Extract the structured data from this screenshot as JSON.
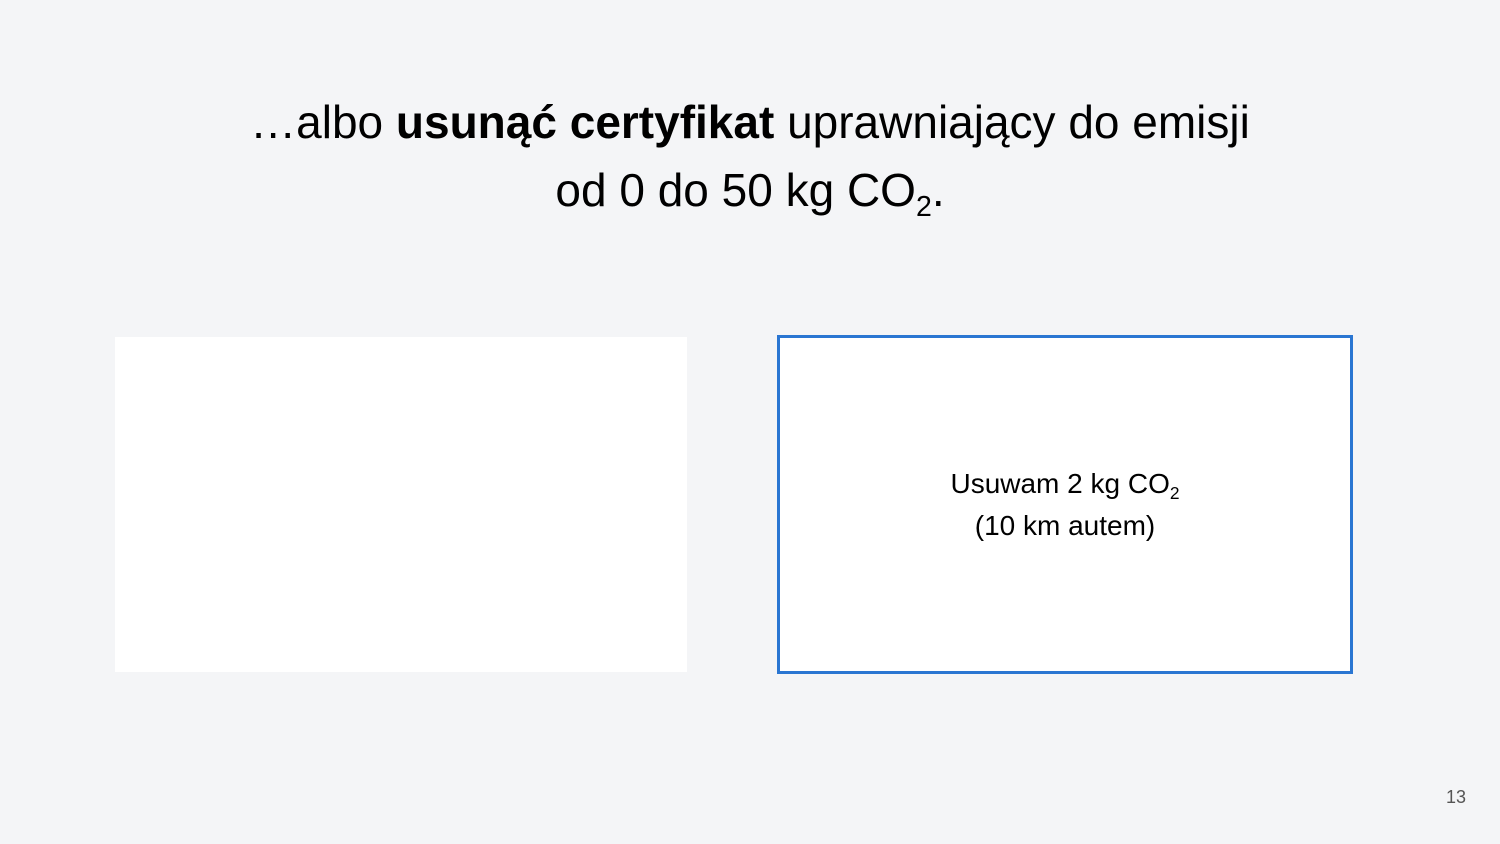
{
  "slide": {
    "title": {
      "line1_prefix": "…albo ",
      "line1_bold": "usunąć certyfikat",
      "line1_suffix": " uprawniający do emisji",
      "line2_main": "od 0 do 50 kg CO",
      "line2_sub": "2",
      "line2_end": "."
    },
    "box": {
      "line1_main": "Usuwam 2 kg CO",
      "line1_sub": "2",
      "line2": "(10 km autem)",
      "border_color": "#2a76d2"
    },
    "page_number": "13"
  }
}
